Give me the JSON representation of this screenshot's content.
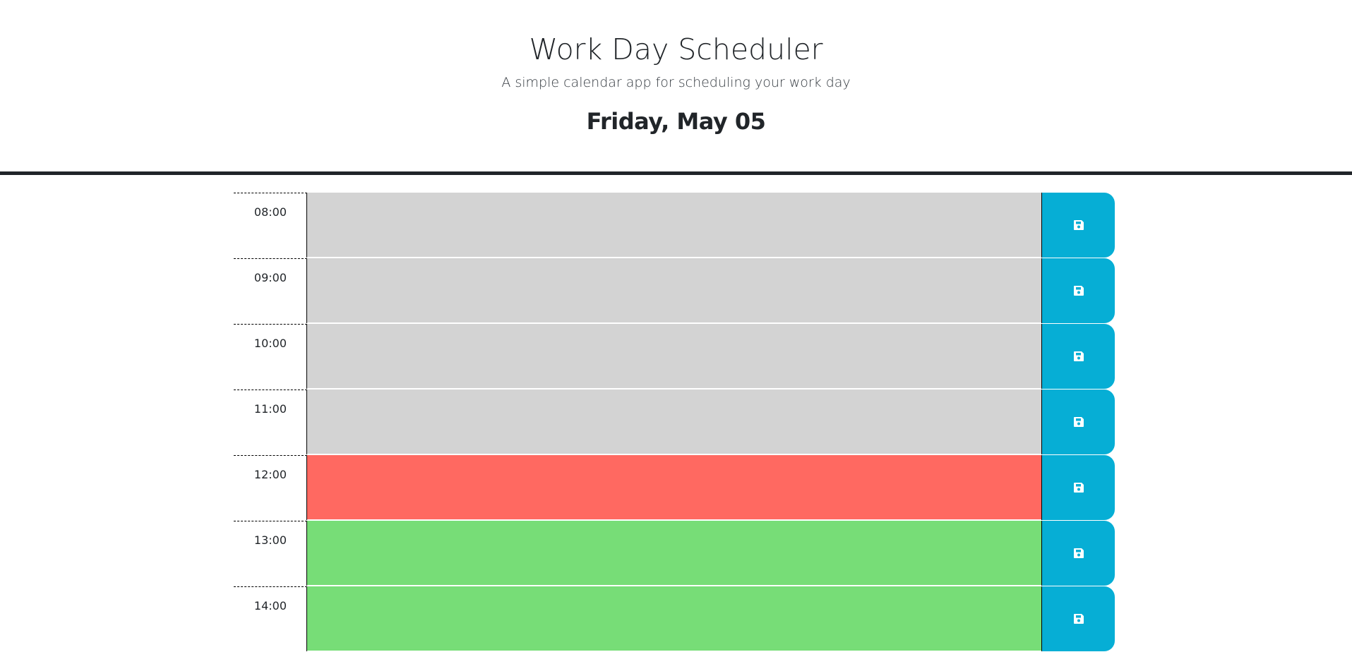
{
  "header": {
    "title": "Work Day Scheduler",
    "subtitle": "A simple calendar app for scheduling your work day",
    "current_day": "Friday, May 05"
  },
  "colors": {
    "past": "#d3d3d3",
    "present": "#ff6961",
    "future": "#77dd77",
    "save_button": "#06aed5"
  },
  "time_blocks": [
    {
      "hour": "08:00",
      "status": "past",
      "text": "",
      "save_icon": "floppy-disk-icon"
    },
    {
      "hour": "09:00",
      "status": "past",
      "text": "",
      "save_icon": "floppy-disk-icon"
    },
    {
      "hour": "10:00",
      "status": "past",
      "text": "",
      "save_icon": "floppy-disk-icon"
    },
    {
      "hour": "11:00",
      "status": "past",
      "text": "",
      "save_icon": "floppy-disk-icon"
    },
    {
      "hour": "12:00",
      "status": "present",
      "text": "",
      "save_icon": "floppy-disk-icon"
    },
    {
      "hour": "13:00",
      "status": "future",
      "text": "",
      "save_icon": "floppy-disk-icon"
    },
    {
      "hour": "14:00",
      "status": "future",
      "text": "",
      "save_icon": "floppy-disk-icon"
    }
  ]
}
